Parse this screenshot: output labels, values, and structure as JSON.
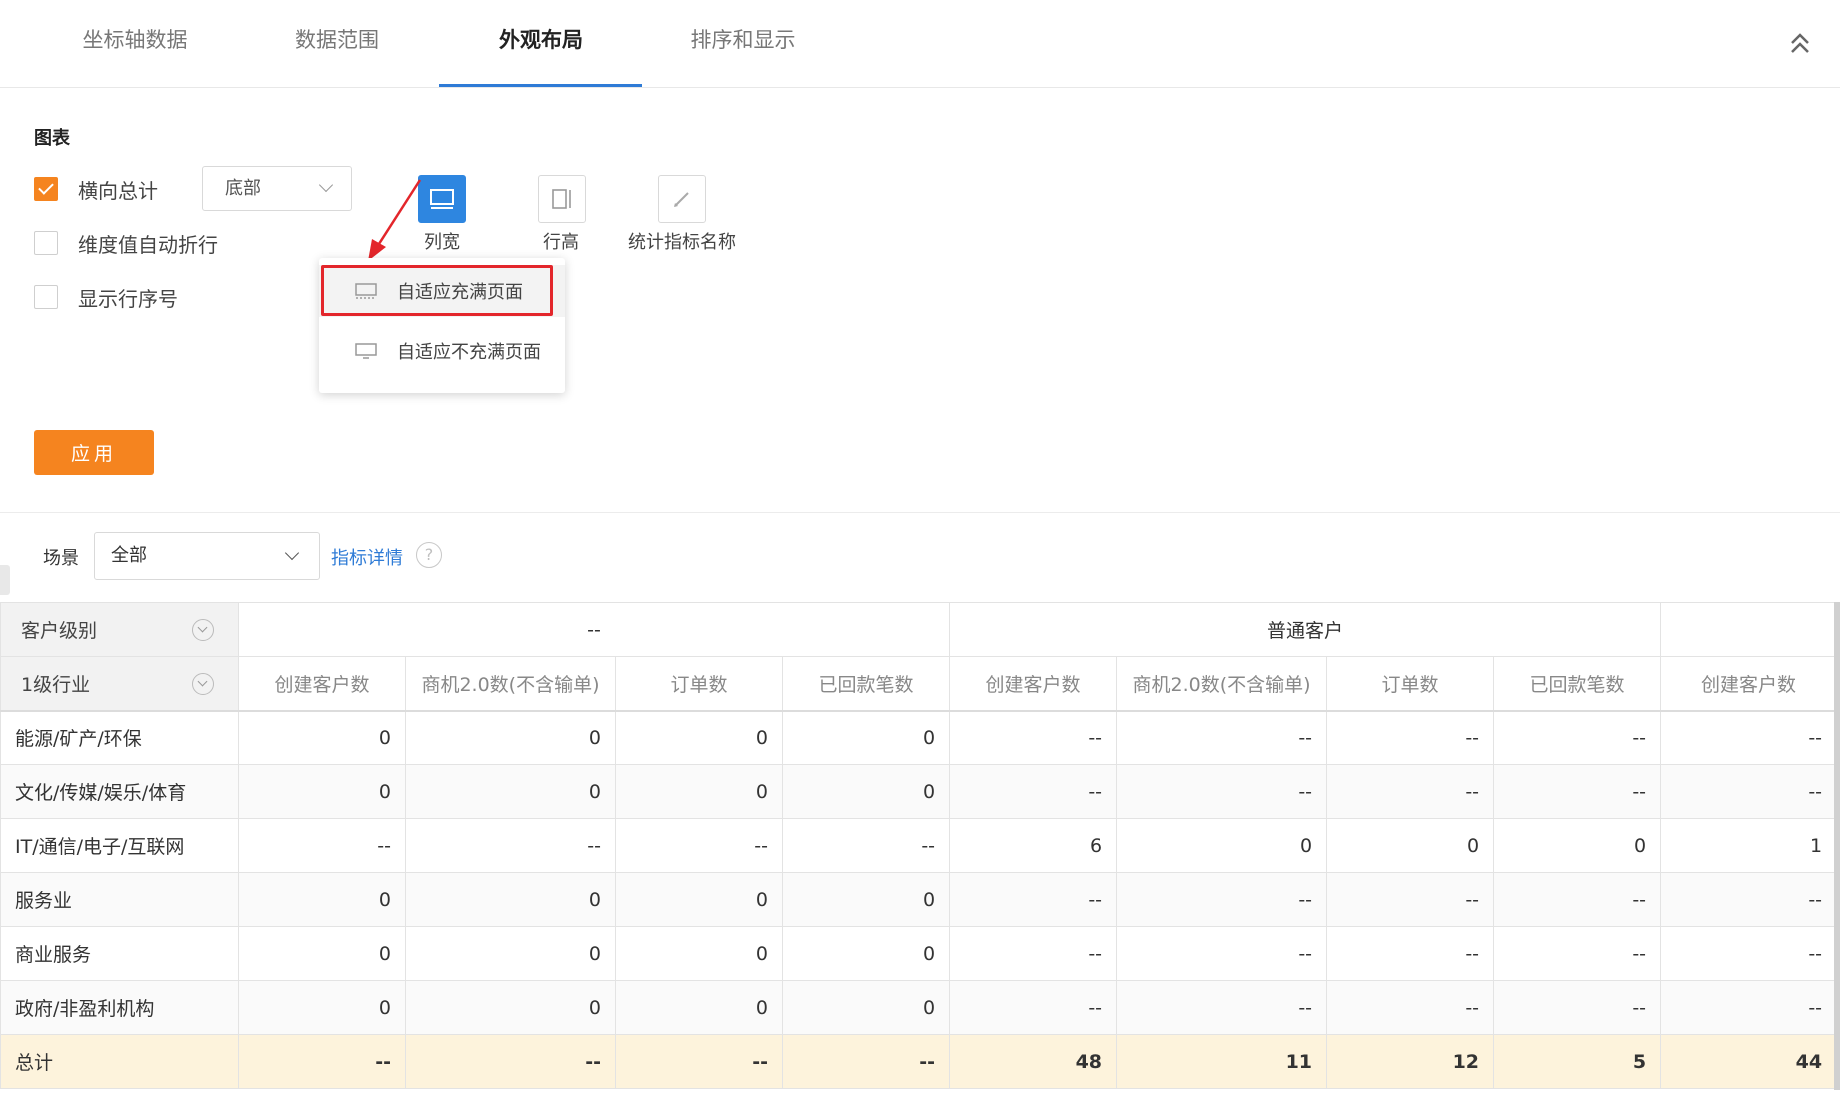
{
  "tabs": [
    {
      "label": "坐标轴数据"
    },
    {
      "label": "数据范围"
    },
    {
      "label": "外观布局"
    },
    {
      "label": "排序和显示"
    }
  ],
  "active_tab": "外观布局",
  "chart_section": {
    "title": "图表",
    "options": [
      {
        "label": "横向总计",
        "checked": true
      },
      {
        "label": "维度值自动折行",
        "checked": false
      },
      {
        "label": "显示行序号",
        "checked": false
      }
    ],
    "total_position": "底部",
    "tools": [
      {
        "label": "列宽",
        "icon": "column-width-icon",
        "active": true
      },
      {
        "label": "行高",
        "icon": "row-height-icon",
        "active": false
      },
      {
        "label": "统计指标名称",
        "icon": "pencil-icon",
        "active": false
      }
    ],
    "width_menu": [
      {
        "label": "自适应充满页面",
        "icon": "monitor-fill-icon"
      },
      {
        "label": "自适应不充满页面",
        "icon": "monitor-icon"
      }
    ],
    "apply_label": "应用"
  },
  "scene_bar": {
    "label": "场景",
    "value": "全部",
    "metric_link": "指标详情",
    "help": "?"
  },
  "table": {
    "header_row1": {
      "dim_label": "客户级别",
      "groups": [
        "--",
        "普通客户",
        ""
      ]
    },
    "header_row2": {
      "dim_label": "1级行业",
      "columns": [
        "创建客户数",
        "商机2.0数(不含输单)",
        "订单数",
        "已回款笔数",
        "创建客户数",
        "商机2.0数(不含输单)",
        "订单数",
        "已回款笔数",
        "创建客户数"
      ]
    },
    "rows": [
      {
        "name": "能源/矿产/环保",
        "values": [
          "0",
          "0",
          "0",
          "0",
          "--",
          "--",
          "--",
          "--",
          "--"
        ]
      },
      {
        "name": "文化/传媒/娱乐/体育",
        "values": [
          "0",
          "0",
          "0",
          "0",
          "--",
          "--",
          "--",
          "--",
          "--"
        ]
      },
      {
        "name": "IT/通信/电子/互联网",
        "values": [
          "--",
          "--",
          "--",
          "--",
          "6",
          "0",
          "0",
          "0",
          "1"
        ]
      },
      {
        "name": "服务业",
        "values": [
          "0",
          "0",
          "0",
          "0",
          "--",
          "--",
          "--",
          "--",
          "--"
        ]
      },
      {
        "name": "商业服务",
        "values": [
          "0",
          "0",
          "0",
          "0",
          "--",
          "--",
          "--",
          "--",
          "--"
        ]
      },
      {
        "name": "政府/非盈利机构",
        "values": [
          "0",
          "0",
          "0",
          "0",
          "--",
          "--",
          "--",
          "--",
          "--"
        ]
      }
    ],
    "total": {
      "name": "总计",
      "values": [
        "--",
        "--",
        "--",
        "--",
        "48",
        "11",
        "12",
        "5",
        "44"
      ]
    }
  },
  "colors": {
    "accent_orange": "#f5841f",
    "active_blue": "#2e7bd6",
    "highlight_red": "#e3262b",
    "total_row_bg": "#fdf3dc"
  }
}
